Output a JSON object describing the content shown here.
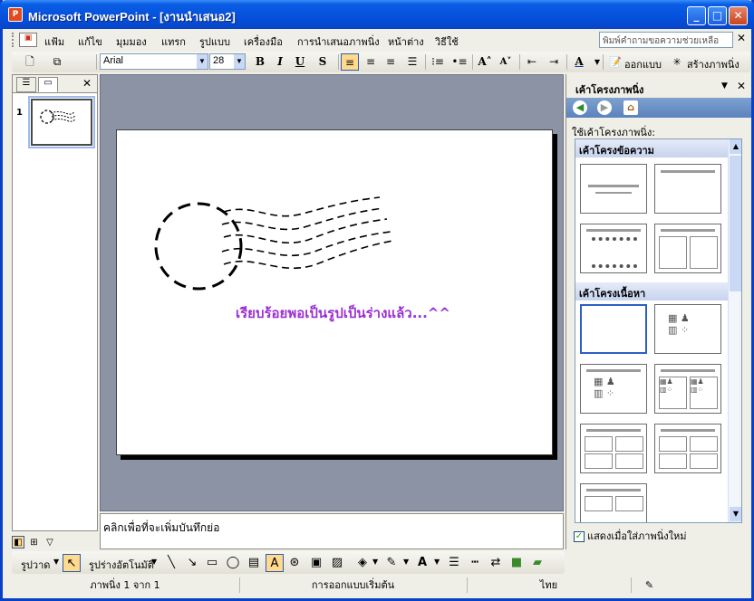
{
  "window": {
    "title": "Microsoft PowerPoint - [งานนำเสนอ2]",
    "app_icon_letter": "P",
    "minimize": "_",
    "maximize": "□",
    "close": "✕"
  },
  "menubar": {
    "items": [
      "แฟ้ม",
      "แก้ไข",
      "มุมมอง",
      "แทรก",
      "รูปแบบ",
      "เครื่องมือ",
      "การนำเสนอภาพนิ่ง",
      "หน้าต่าง",
      "วิธีใช้"
    ],
    "help_placeholder": "พิมพ์คำถามขอความช่วยเหลือ",
    "help_close": "✕"
  },
  "toolbar": {
    "font_name": "Arial",
    "font_size": "28",
    "bold": "B",
    "italic": "I",
    "underline": "U",
    "shadow": "S",
    "design_label": "ออกแบบ",
    "new_slide_label": "สร้างภาพนิ่ง"
  },
  "left_pane": {
    "slide_number": "1",
    "close": "✕"
  },
  "slide": {
    "caption": "เรียบร้อยพอเป็นรูปเป็นร่างแล้ว...^^"
  },
  "notes": {
    "placeholder": "คลิกเพื่อที่จะเพิ่มบันทึกย่อ"
  },
  "task_pane": {
    "title": "เค้าโครงภาพนิ่ง",
    "apply_label": "ใช้เค้าโครงภาพนิ่ง:",
    "section_text_layouts": "เค้าโครงข้อความ",
    "section_content_layouts": "เค้าโครงเนื้อหา",
    "show_on_insert_label": "แสดงเมื่อใส่ภาพนิ่งใหม่",
    "show_on_insert_checked": true
  },
  "draw_toolbar": {
    "draw_label": "รูปวาด",
    "autoshapes_label": "รูปร่างอัตโนมัติ"
  },
  "statusbar": {
    "slide_position": "ภาพนิ่ง 1 จาก 1",
    "design_name": "การออกแบบเริ่มต้น",
    "language": "ไทย"
  },
  "colors": {
    "caption": "#9b2fd1",
    "titlebar": "#0550dc",
    "section_header": "#c7d3ef"
  }
}
